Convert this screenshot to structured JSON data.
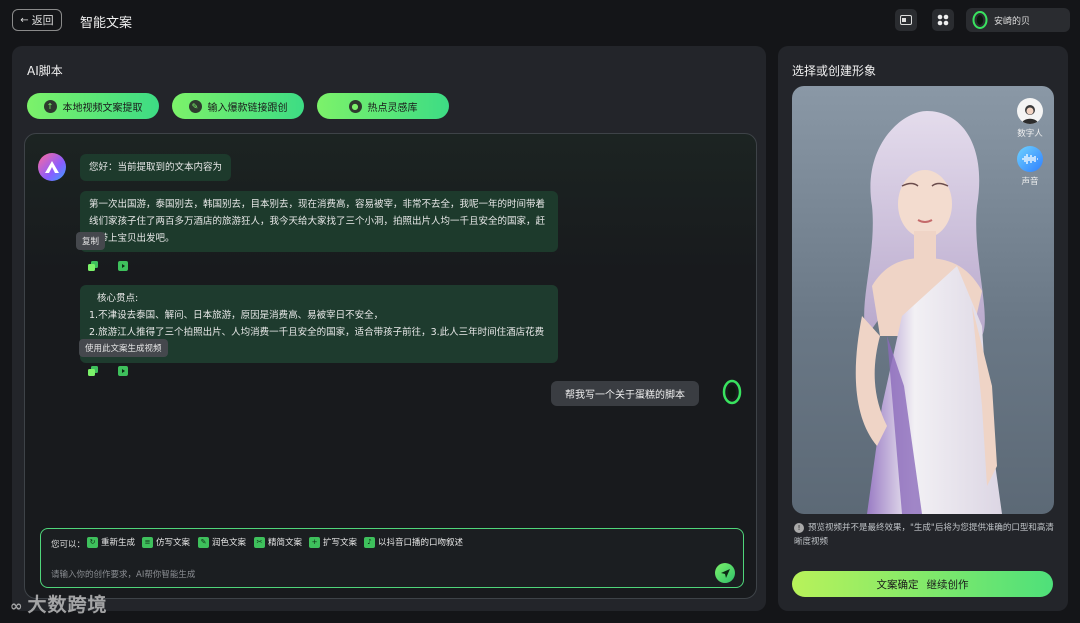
{
  "topbar": {
    "back_label": "返回",
    "title": "智能文案",
    "user_name": "安崎的贝"
  },
  "left": {
    "title": "AI脚本",
    "tools": [
      {
        "label": "本地视频文案提取",
        "icon": "upload-icon"
      },
      {
        "label": "输入爆款链接跟创",
        "icon": "pencil-icon"
      },
      {
        "label": "热点灵感库",
        "icon": "bulb-icon"
      }
    ],
    "messages": {
      "greeting": "您好：当前提取到的文本内容为",
      "extracted_text": "第一次出国游，泰国别去，韩国别去，目本别去，现在消费高，容易被宰，非常不去全，我呢一年的时间带着线们家孩子住了两百多万酒店的旅游狂人，我今天给大家找了三个小洞，拍照出片人均一千且安全的国家，赶紧带上宝贝出发吧。",
      "copy_tooltip": "复制",
      "core_title": "核心贯点:",
      "core_point_1": "1.不津设去泰国、解问、日本旅游，原因是消费高、易被宰日不安全，",
      "core_point_2": "2.旅游江人推得了三个拍照出片、人均消费一千且安全的国家，适合带孩子前往，3.此人三年时间住酒店花费两自多万。",
      "gen_video_tooltip": "使用此文案生成视频",
      "user_message": "帮我写一个关于蛋糕的脚本"
    },
    "input": {
      "label": "您可以：",
      "chips": [
        "重新生成",
        "仿写文案",
        "润色文案",
        "精简文案",
        "扩写文案",
        "以抖音口播的口吻叙述"
      ],
      "placeholder": "请输入你的创作要求，AI帮你智能生成"
    }
  },
  "right": {
    "title": "选择或创建形象",
    "options": [
      {
        "label": "数字人"
      },
      {
        "label": "声音"
      }
    ],
    "note": "预览视频并不是最终效果，\"生成\"后将为您提供准确的口型和高清晰度视频",
    "confirm_label": "文案确定",
    "continue_label": "继续创作"
  },
  "watermark": "大数跨境",
  "colors": {
    "accent": "#4ee07a",
    "background": "#141518",
    "panel": "#23252a"
  }
}
